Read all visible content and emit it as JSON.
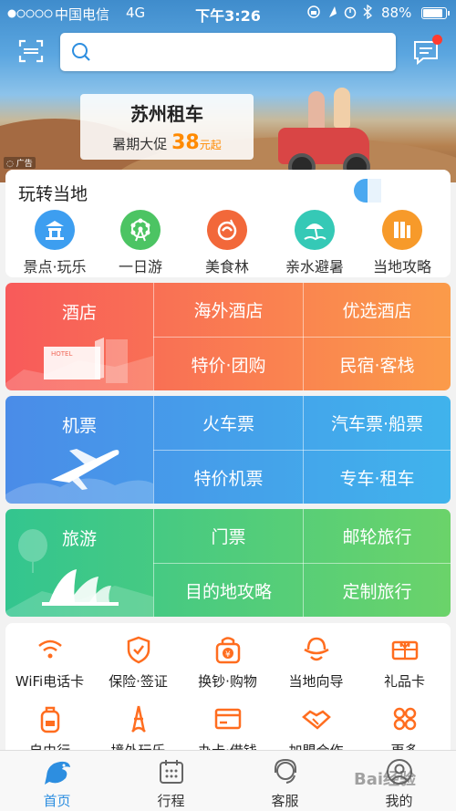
{
  "status_bar": {
    "carrier": "中国电信",
    "network": "4G",
    "time": "下午3:26",
    "battery": "88%",
    "battery_level": 0.88
  },
  "header": {
    "search_placeholder": ""
  },
  "banner": {
    "title": "苏州租车",
    "promo_prefix": "暑期大促",
    "promo_number": "38",
    "promo_unit": "元起",
    "ad_label": "广告"
  },
  "local_play": {
    "title": "玩转当地",
    "items": [
      {
        "label": "景点·玩乐",
        "icon": "pavilion-icon",
        "color": "#3d9ef0"
      },
      {
        "label": "一日游",
        "icon": "ferris-wheel-icon",
        "color": "#4cc463"
      },
      {
        "label": "美食林",
        "icon": "food-icon",
        "color": "#f2683a"
      },
      {
        "label": "亲水避暑",
        "icon": "beach-umbrella-icon",
        "color": "#35c9b6"
      },
      {
        "label": "当地攻略",
        "icon": "guide-book-icon",
        "color": "#f79a2a"
      }
    ]
  },
  "grid": {
    "hotel": {
      "main": "酒店",
      "cells": [
        "海外酒店",
        "优选酒店",
        "特价·团购",
        "民宿·客栈"
      ],
      "color_from": "#f85a5a",
      "color_to": "#fb9b4a"
    },
    "flight": {
      "main": "机票",
      "cells": [
        "火车票",
        "汽车票·船票",
        "特价机票",
        "专车·租车"
      ],
      "color_from": "#4a8ce8",
      "color_to": "#40b3ec"
    },
    "travel": {
      "main": "旅游",
      "cells": [
        "门票",
        "邮轮旅行",
        "目的地攻略",
        "定制旅行"
      ],
      "color_from": "#33c58f",
      "color_to": "#6bd36a"
    }
  },
  "tools": {
    "row1": [
      {
        "label": "WiFi电话卡",
        "icon": "wifi-icon"
      },
      {
        "label": "保险·签证",
        "icon": "shield-icon"
      },
      {
        "label": "换钞·购物",
        "icon": "currency-bag-icon"
      },
      {
        "label": "当地向导",
        "icon": "guide-hat-icon"
      },
      {
        "label": "礼品卡",
        "icon": "gift-card-icon"
      }
    ],
    "row2": [
      {
        "label": "自由行",
        "icon": "backpack-icon"
      },
      {
        "label": "境外玩乐",
        "icon": "eiffel-tower-icon"
      },
      {
        "label": "办卡·借钱",
        "icon": "credit-card-icon"
      },
      {
        "label": "加盟合作",
        "icon": "handshake-icon"
      },
      {
        "label": "更多",
        "icon": "more-icon"
      }
    ],
    "accent": "#ff6d1f"
  },
  "tabbar": {
    "tabs": [
      {
        "label": "首页",
        "icon": "home-dolphin-icon"
      },
      {
        "label": "行程",
        "icon": "calendar-icon"
      },
      {
        "label": "客服",
        "icon": "headset-icon"
      },
      {
        "label": "我的",
        "icon": "profile-icon"
      }
    ],
    "active_color": "#2d8ee0"
  },
  "watermark": "Bai经验"
}
